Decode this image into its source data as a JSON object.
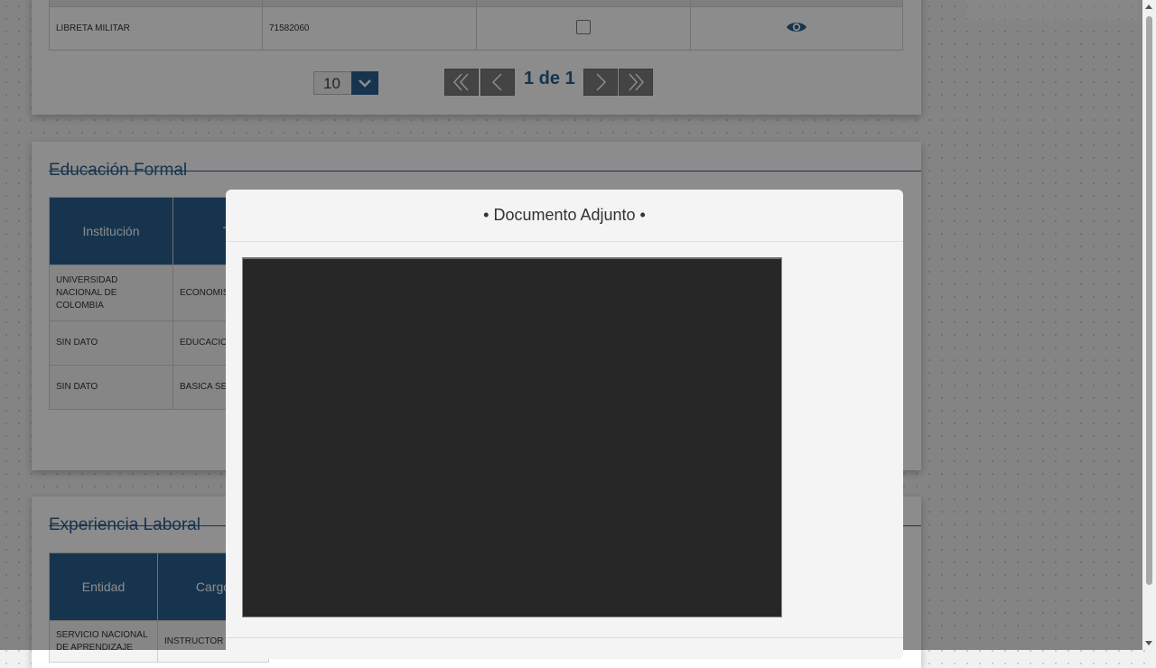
{
  "documents": {
    "row": {
      "type": "LIBRETA MILITAR",
      "number": "71582060"
    },
    "view_icon": "eye-icon"
  },
  "pager": {
    "page_size": "10",
    "page_info": "1 de 1",
    "icons": {
      "first": "double-chevron-left-icon",
      "prev": "chevron-left-icon",
      "next": "chevron-right-icon",
      "last": "double-chevron-right-icon",
      "dropdown": "chevron-down-icon"
    }
  },
  "education": {
    "title": "Educación Formal",
    "headers": [
      "Institución",
      "Tí"
    ],
    "rows": [
      {
        "institution": "UNIVERSIDAD NACIONAL DE COLOMBIA",
        "title": "ECONOMIS"
      },
      {
        "institution": "SIN DATO",
        "title": "EDUCACIO"
      },
      {
        "institution": "SIN DATO",
        "title": "BASICA SE"
      }
    ]
  },
  "experience": {
    "title": "Experiencia Laboral",
    "headers": [
      "Entidad",
      "Cargo"
    ],
    "rows": [
      {
        "entity": "SERVICIO NACIONAL DE APRENDIZAJE",
        "role": "INSTRUCTOR"
      }
    ]
  },
  "modal": {
    "title": "• Documento Adjunto •"
  },
  "colors": {
    "primary": "#2b5f8f",
    "overlay": "rgba(0,0,0,0.45)",
    "viewer": "#272727"
  }
}
